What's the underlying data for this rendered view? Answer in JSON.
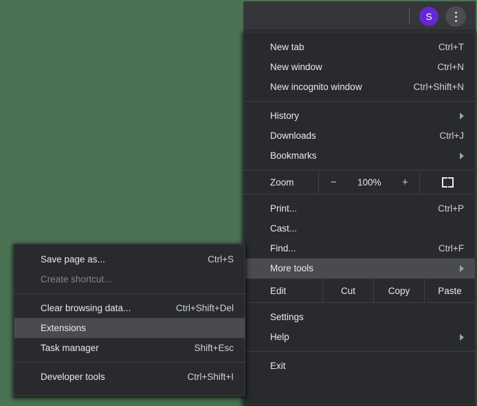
{
  "page": {
    "background_color": "#4a7354"
  },
  "toolbar": {
    "profile_initial": "S",
    "profile_name": "profile-avatar",
    "menu_button_name": "three-dot-menu-button"
  },
  "main_menu": {
    "highlighted_item": "More tools",
    "groups": [
      {
        "items": [
          {
            "label": "New tab",
            "shortcut": "Ctrl+T",
            "arrow": false,
            "disabled": false
          },
          {
            "label": "New window",
            "shortcut": "Ctrl+N",
            "arrow": false,
            "disabled": false
          },
          {
            "label": "New incognito window",
            "shortcut": "Ctrl+Shift+N",
            "arrow": false,
            "disabled": false
          }
        ]
      },
      {
        "items": [
          {
            "label": "History",
            "shortcut": "",
            "arrow": true,
            "disabled": false
          },
          {
            "label": "Downloads",
            "shortcut": "Ctrl+J",
            "arrow": false,
            "disabled": false
          },
          {
            "label": "Bookmarks",
            "shortcut": "",
            "arrow": true,
            "disabled": false
          }
        ]
      }
    ],
    "zoom_row": {
      "label": "Zoom",
      "minus_label": "−",
      "value": "100%",
      "plus_label": "+",
      "fullscreen_icon": "fullscreen-icon"
    },
    "middle_items": [
      {
        "label": "Print...",
        "shortcut": "Ctrl+P",
        "arrow": false,
        "disabled": false
      },
      {
        "label": "Cast...",
        "shortcut": "",
        "arrow": false,
        "disabled": false
      },
      {
        "label": "Find...",
        "shortcut": "Ctrl+F",
        "arrow": false,
        "disabled": false
      },
      {
        "label": "More tools",
        "shortcut": "",
        "arrow": true,
        "disabled": false
      }
    ],
    "edit_row": {
      "label": "Edit",
      "actions": [
        "Cut",
        "Copy",
        "Paste"
      ]
    },
    "bottom_items": [
      {
        "label": "Settings",
        "shortcut": "",
        "arrow": false,
        "disabled": false
      },
      {
        "label": "Help",
        "shortcut": "",
        "arrow": true,
        "disabled": false
      }
    ],
    "exit_item": {
      "label": "Exit",
      "shortcut": "",
      "arrow": false,
      "disabled": false
    }
  },
  "submenu": {
    "name": "More tools",
    "highlighted_item": "Extensions",
    "group_1": [
      {
        "label": "Save page as...",
        "shortcut": "Ctrl+S",
        "disabled": false
      },
      {
        "label": "Create shortcut...",
        "shortcut": "",
        "disabled": true
      }
    ],
    "group_2": [
      {
        "label": "Clear browsing data...",
        "shortcut": "Ctrl+Shift+Del",
        "disabled": false
      },
      {
        "label": "Extensions",
        "shortcut": "",
        "disabled": false
      },
      {
        "label": "Task manager",
        "shortcut": "Shift+Esc",
        "disabled": false
      }
    ],
    "group_3": [
      {
        "label": "Developer tools",
        "shortcut": "Ctrl+Shift+I",
        "disabled": false
      }
    ]
  }
}
